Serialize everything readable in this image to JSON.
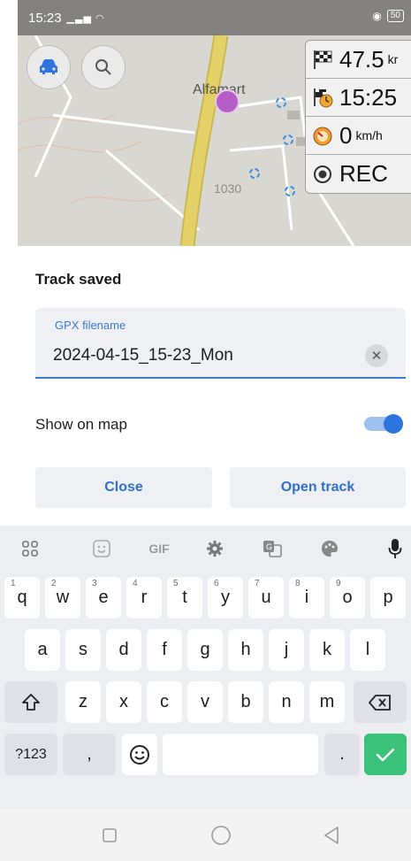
{
  "status_bar": {
    "time": "15:23",
    "battery": "50"
  },
  "map": {
    "poi_name": "Alfamart",
    "elevation_label": "1030",
    "widgets": [
      {
        "icon": "checkered-flag-icon",
        "value": "47.5",
        "unit": "kr"
      },
      {
        "icon": "arrival-clock-icon",
        "value": "15:25",
        "unit": ""
      },
      {
        "icon": "speedometer-icon",
        "value": "0",
        "unit": "km/h"
      },
      {
        "icon": "record-icon",
        "value": "REC",
        "unit": ""
      }
    ]
  },
  "dialog": {
    "title": "Track saved",
    "field_label": "GPX filename",
    "field_value": "2024-04-15_15-23_Mon",
    "clear_glyph": "✕",
    "toggle_label": "Show on map",
    "toggle_on": true,
    "close_label": "Close",
    "open_label": "Open track"
  },
  "keyboard": {
    "toolbar": {
      "gif": "GIF"
    },
    "row1": [
      {
        "k": "q",
        "hint": "1"
      },
      {
        "k": "w",
        "hint": "2"
      },
      {
        "k": "e",
        "hint": "3"
      },
      {
        "k": "r",
        "hint": "4"
      },
      {
        "k": "t",
        "hint": "5"
      },
      {
        "k": "y",
        "hint": "6"
      },
      {
        "k": "u",
        "hint": "7"
      },
      {
        "k": "i",
        "hint": "8"
      },
      {
        "k": "o",
        "hint": "9"
      },
      {
        "k": "p",
        "hint": ""
      }
    ],
    "row2": [
      "a",
      "s",
      "d",
      "f",
      "g",
      "h",
      "j",
      "k",
      "l"
    ],
    "row3": [
      "z",
      "x",
      "c",
      "v",
      "b",
      "n",
      "m"
    ],
    "symbols_label": "?123",
    "comma": ",",
    "period": "."
  },
  "colors": {
    "accent": "#2f74de",
    "enter_key": "#3ac27a",
    "route": "#e3d067",
    "poi": "#b65ec7"
  }
}
